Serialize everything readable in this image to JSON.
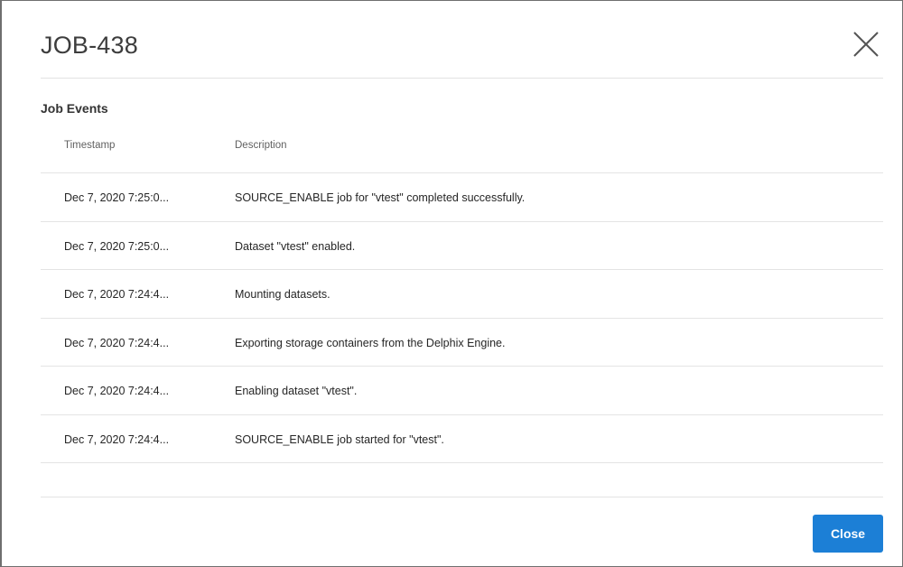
{
  "modal": {
    "title": "JOB-438",
    "section_label": "Job Events",
    "close_button_label": "Close"
  },
  "table": {
    "columns": [
      "Timestamp",
      "Description"
    ],
    "rows": [
      {
        "timestamp": "Dec 7, 2020 7:25:0...",
        "description": "SOURCE_ENABLE job for \"vtest\" completed successfully."
      },
      {
        "timestamp": "Dec 7, 2020 7:25:0...",
        "description": "Dataset \"vtest\" enabled."
      },
      {
        "timestamp": "Dec 7, 2020 7:24:4...",
        "description": "Mounting datasets."
      },
      {
        "timestamp": "Dec 7, 2020 7:24:4...",
        "description": "Exporting storage containers from the Delphix Engine."
      },
      {
        "timestamp": "Dec 7, 2020 7:24:4...",
        "description": "Enabling dataset \"vtest\"."
      },
      {
        "timestamp": "Dec 7, 2020 7:24:4...",
        "description": "SOURCE_ENABLE job started for \"vtest\"."
      }
    ]
  },
  "colors": {
    "primary_button": "#1c7fd6",
    "title_text": "#3d3d3d",
    "divider": "#e4e4e4"
  },
  "icons": {
    "close": "close-icon"
  }
}
